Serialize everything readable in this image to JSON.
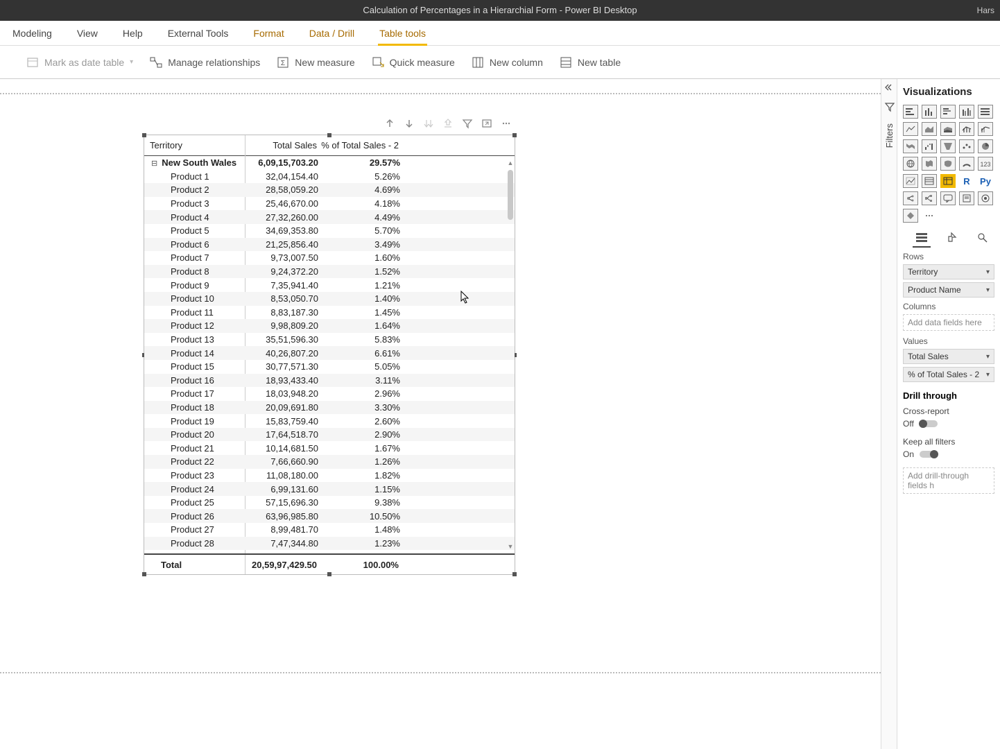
{
  "window": {
    "title": "Calculation of Percentages in a Hierarchial Form - Power BI Desktop",
    "user": "Hars"
  },
  "tabs": {
    "modeling": "Modeling",
    "view": "View",
    "help": "Help",
    "external": "External Tools",
    "format": "Format",
    "datadrill": "Data / Drill",
    "tabletools": "Table tools"
  },
  "toolbar": {
    "date_table": "Mark as date table",
    "relationships": "Manage relationships",
    "new_measure": "New measure",
    "quick_measure": "Quick measure",
    "new_column": "New column",
    "new_table": "New table"
  },
  "matrix": {
    "headers": {
      "territory": "Territory",
      "total_sales": "Total Sales",
      "pct": "% of Total Sales - 2"
    },
    "group": {
      "name": "New South Wales",
      "sales": "6,09,15,703.20",
      "pct": "29.57%"
    },
    "rows": [
      {
        "name": "Product 1",
        "sales": "32,04,154.40",
        "pct": "5.26%"
      },
      {
        "name": "Product 2",
        "sales": "28,58,059.20",
        "pct": "4.69%"
      },
      {
        "name": "Product 3",
        "sales": "25,46,670.00",
        "pct": "4.18%"
      },
      {
        "name": "Product 4",
        "sales": "27,32,260.00",
        "pct": "4.49%"
      },
      {
        "name": "Product 5",
        "sales": "34,69,353.80",
        "pct": "5.70%"
      },
      {
        "name": "Product 6",
        "sales": "21,25,856.40",
        "pct": "3.49%"
      },
      {
        "name": "Product 7",
        "sales": "9,73,007.50",
        "pct": "1.60%"
      },
      {
        "name": "Product 8",
        "sales": "9,24,372.20",
        "pct": "1.52%"
      },
      {
        "name": "Product 9",
        "sales": "7,35,941.40",
        "pct": "1.21%"
      },
      {
        "name": "Product 10",
        "sales": "8,53,050.70",
        "pct": "1.40%"
      },
      {
        "name": "Product 11",
        "sales": "8,83,187.30",
        "pct": "1.45%"
      },
      {
        "name": "Product 12",
        "sales": "9,98,809.20",
        "pct": "1.64%"
      },
      {
        "name": "Product 13",
        "sales": "35,51,596.30",
        "pct": "5.83%"
      },
      {
        "name": "Product 14",
        "sales": "40,26,807.20",
        "pct": "6.61%"
      },
      {
        "name": "Product 15",
        "sales": "30,77,571.30",
        "pct": "5.05%"
      },
      {
        "name": "Product 16",
        "sales": "18,93,433.40",
        "pct": "3.11%"
      },
      {
        "name": "Product 17",
        "sales": "18,03,948.20",
        "pct": "2.96%"
      },
      {
        "name": "Product 18",
        "sales": "20,09,691.80",
        "pct": "3.30%"
      },
      {
        "name": "Product 19",
        "sales": "15,83,759.40",
        "pct": "2.60%"
      },
      {
        "name": "Product 20",
        "sales": "17,64,518.70",
        "pct": "2.90%"
      },
      {
        "name": "Product 21",
        "sales": "10,14,681.50",
        "pct": "1.67%"
      },
      {
        "name": "Product 22",
        "sales": "7,66,660.90",
        "pct": "1.26%"
      },
      {
        "name": "Product 23",
        "sales": "11,08,180.00",
        "pct": "1.82%"
      },
      {
        "name": "Product 24",
        "sales": "6,99,131.60",
        "pct": "1.15%"
      },
      {
        "name": "Product 25",
        "sales": "57,15,696.30",
        "pct": "9.38%"
      },
      {
        "name": "Product 26",
        "sales": "63,96,985.80",
        "pct": "10.50%"
      },
      {
        "name": "Product 27",
        "sales": "8,99,481.70",
        "pct": "1.48%"
      },
      {
        "name": "Product 28",
        "sales": "7,47,344.80",
        "pct": "1.23%"
      }
    ],
    "total": {
      "name": "Total",
      "sales": "20,59,97,429.50",
      "pct": "100.00%"
    }
  },
  "filters_pane": {
    "label": "Filters"
  },
  "viz_pane": {
    "title": "Visualizations",
    "rows_label": "Rows",
    "rows_fields": {
      "territory": "Territory",
      "product": "Product Name"
    },
    "columns_label": "Columns",
    "columns_drop": "Add data fields here",
    "values_label": "Values",
    "values_fields": {
      "total_sales": "Total Sales",
      "pct": "% of Total Sales - 2"
    },
    "drill_title": "Drill through",
    "cross_report": "Cross-report",
    "cross_state": "Off",
    "keep_filters": "Keep all filters",
    "keep_state": "On",
    "drill_drop": "Add drill-through fields h"
  }
}
